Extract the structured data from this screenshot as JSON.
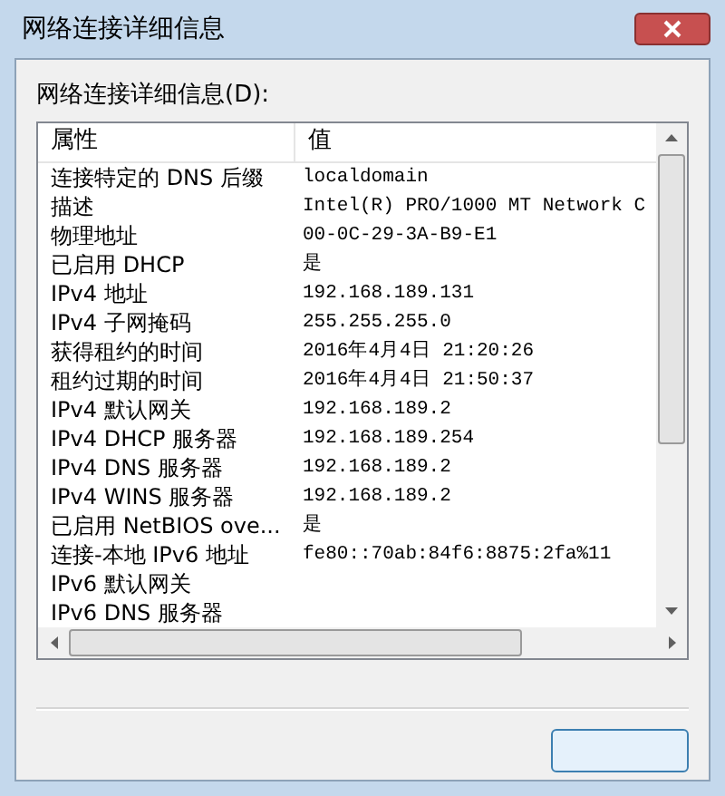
{
  "window": {
    "title": "网络连接详细信息"
  },
  "list_label": "网络连接详细信息(D):",
  "table": {
    "columns": [
      "属性",
      "值"
    ],
    "rows": [
      {
        "property": "连接特定的 DNS 后缀",
        "value": "localdomain"
      },
      {
        "property": "描述",
        "value": "Intel(R) PRO/1000 MT Network C"
      },
      {
        "property": "物理地址",
        "value": "00-0C-29-3A-B9-E1"
      },
      {
        "property": "已启用 DHCP",
        "value": "是"
      },
      {
        "property": "IPv4 地址",
        "value": "192.168.189.131"
      },
      {
        "property": "IPv4 子网掩码",
        "value": "255.255.255.0"
      },
      {
        "property": "获得租约的时间",
        "value": "2016年4月4日 21:20:26"
      },
      {
        "property": "租约过期的时间",
        "value": "2016年4月4日 21:50:37"
      },
      {
        "property": "IPv4 默认网关",
        "value": "192.168.189.2"
      },
      {
        "property": "IPv4 DHCP 服务器",
        "value": "192.168.189.254"
      },
      {
        "property": "IPv4 DNS 服务器",
        "value": "192.168.189.2"
      },
      {
        "property": "IPv4 WINS 服务器",
        "value": "192.168.189.2"
      },
      {
        "property": "已启用 NetBIOS ove...",
        "value": "是"
      },
      {
        "property": "连接-本地 IPv6 地址",
        "value": "fe80::70ab:84f6:8875:2fa%11"
      },
      {
        "property": "IPv6 默认网关"
      },
      {
        "property": "IPv6 DNS 服务器"
      }
    ]
  }
}
